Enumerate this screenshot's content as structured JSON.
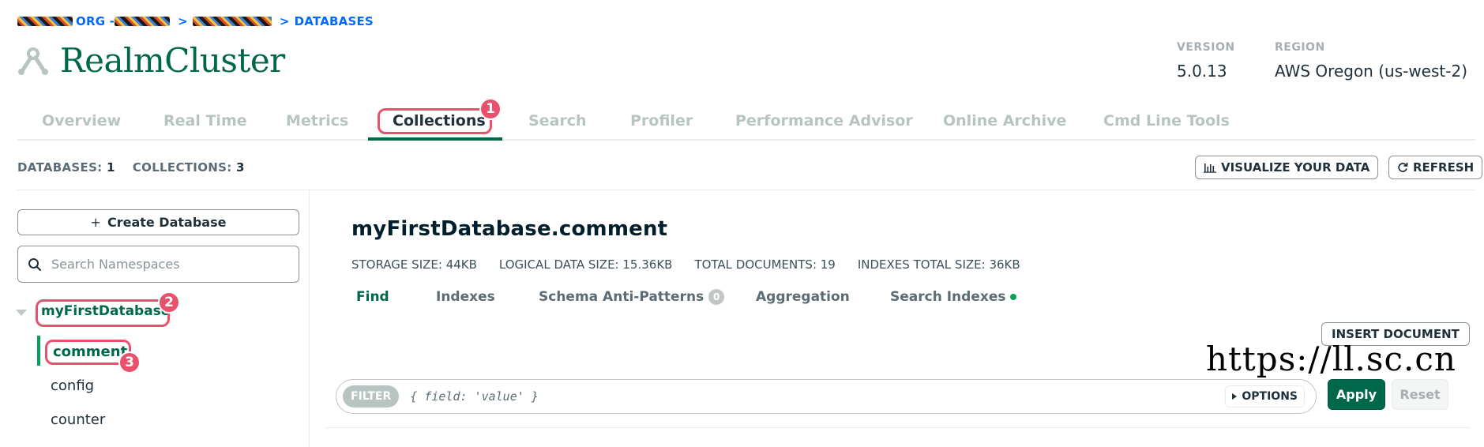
{
  "breadcrumb": {
    "org_label": "ORG - ",
    "sep1": ">",
    "sep2": ">",
    "databases_label": "DATABASES"
  },
  "cluster": {
    "title": "RealmCluster",
    "version_key": "VERSION",
    "version_value": "5.0.13",
    "region_key": "REGION",
    "region_value": "AWS Oregon (us-west-2)"
  },
  "tabs": [
    {
      "label": "Overview"
    },
    {
      "label": "Real Time"
    },
    {
      "label": "Metrics"
    },
    {
      "label": "Collections"
    },
    {
      "label": "Search"
    },
    {
      "label": "Profiler"
    },
    {
      "label": "Performance Advisor"
    },
    {
      "label": "Online Archive"
    },
    {
      "label": "Cmd Line Tools"
    }
  ],
  "annotations": [
    "1",
    "2",
    "3"
  ],
  "stats": {
    "databases_label": "DATABASES:",
    "databases_value": "1",
    "collections_label": "COLLECTIONS:",
    "collections_value": "3"
  },
  "toolbar": {
    "visualize_label": "VISUALIZE YOUR DATA",
    "refresh_label": "REFRESH"
  },
  "sidebar": {
    "create_db_plus": "+",
    "create_db_label": "Create Database",
    "search_placeholder": "Search Namespaces",
    "database": "myFirstDatabase",
    "collections": [
      "comment",
      "config",
      "counter"
    ]
  },
  "namespace": {
    "title": "myFirstDatabase.comment",
    "storage_size": "STORAGE SIZE: 44KB",
    "logical_size": "LOGICAL DATA SIZE: 15.36KB",
    "total_docs": "TOTAL DOCUMENTS: 19",
    "indexes_size": "INDEXES TOTAL SIZE: 36KB"
  },
  "subtabs": {
    "find": "Find",
    "indexes": "Indexes",
    "schema": "Schema Anti-Patterns",
    "schema_count": "0",
    "aggregation": "Aggregation",
    "search_indexes": "Search Indexes"
  },
  "query": {
    "insert_label": "INSERT DOCUMENT",
    "filter_badge": "FILTER",
    "filter_placeholder": "{ field: 'value' }",
    "options_label": "OPTIONS",
    "apply_label": "Apply",
    "reset_label": "Reset"
  },
  "watermark": "https://ll.sc.cn",
  "colors": {
    "accent": "#00684a",
    "highlight": "#e8506b",
    "link": "#016bf8"
  }
}
